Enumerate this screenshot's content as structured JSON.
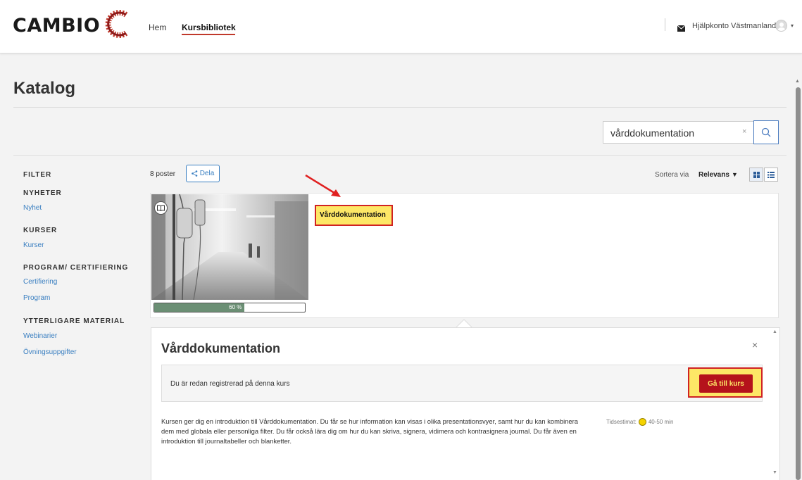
{
  "header": {
    "logo_text": "CAMBIO",
    "nav": {
      "home": "Hem",
      "library": "Kursbibliotek"
    },
    "account_name": "Hjälpkonto Västmanland",
    "caret": "▾"
  },
  "page": {
    "title": "Katalog"
  },
  "search": {
    "value": "vårddokumentation",
    "clear": "×"
  },
  "filters": {
    "title": "FILTER",
    "groups": [
      {
        "heading": "NYHETER",
        "links": [
          "Nyhet"
        ]
      },
      {
        "heading": "KURSER",
        "links": [
          "Kurser"
        ]
      },
      {
        "heading": "PROGRAM/ CERTIFIERING",
        "links": [
          "Certifiering",
          "Program"
        ]
      },
      {
        "heading": "YTTERLIGARE MATERIAL",
        "links": [
          "Webinarier",
          "Övningsuppgifter"
        ]
      }
    ]
  },
  "results": {
    "count": "8 poster",
    "share_label": "Dela",
    "sort_label": "Sortera via",
    "sort_value": "Relevans",
    "sort_caret": "▼"
  },
  "card": {
    "title": "Vårddokumentation",
    "progress_text": "60 %",
    "progress_value": 0.6
  },
  "detail": {
    "title": "Vårddokumentation",
    "close": "×",
    "registered_text": "Du är redan registrerad på denna kurs",
    "goto_button": "Gå till kurs",
    "description": "Kursen ger dig en introduktion till Vårddokumentation. Du får se hur information kan visas i olika presentationsvyer, samt hur du kan kombinera dem med globala eller personliga filter. Du får också lära dig om hur du kan skriva, signera, vidimera och kontrasignera journal. Du får även en introduktion till journaltabeller och blanketter.",
    "estimate_label": "Tidsestimat:",
    "estimate_value": "40-50 min"
  },
  "colors": {
    "brand_red": "#b5121b",
    "link_blue": "#3a7fc1",
    "highlight_yellow": "#fde766",
    "annotation_red": "#d02222",
    "progress_green": "#6b8f74"
  },
  "icons": [
    "cambio-logo-mark",
    "mail-icon",
    "avatar-icon",
    "search-icon",
    "share-icon",
    "grid-view-icon",
    "list-view-icon",
    "book-icon",
    "close-icon",
    "clock-icon",
    "annotation-arrow"
  ]
}
